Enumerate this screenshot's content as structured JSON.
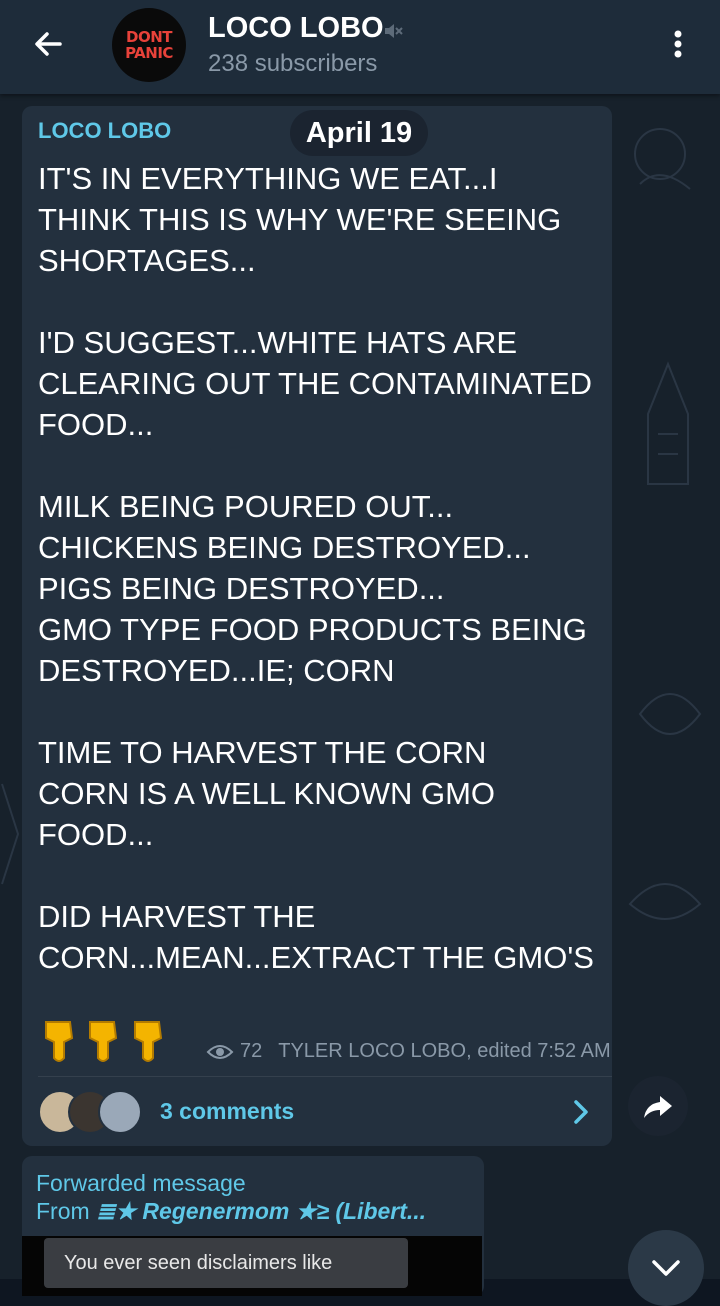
{
  "header": {
    "channel_name": "LOCO LOBO",
    "subscribers": "238 subscribers",
    "avatar_text_line1": "DONT",
    "avatar_text_line2": "PANIC"
  },
  "message": {
    "sender": "LOCO LOBO",
    "date": "April 19",
    "text": "IT'S IN EVERYTHING WE EAT...I THINK THIS IS WHY WE'RE SEEING SHORTAGES...\n\nI'D SUGGEST...WHITE HATS ARE CLEARING OUT THE CONTAMINATED FOOD...\n\nMILK BEING POURED OUT...\nCHICKENS BEING DESTROYED...\nPIGS BEING DESTROYED...\nGMO TYPE FOOD PRODUCTS BEING DESTROYED...IE; CORN\n\nTIME TO HARVEST THE CORN\nCORN IS A WELL KNOWN GMO FOOD...\n\nDID HARVEST THE CORN...MEAN...EXTRACT THE GMO'S",
    "emoji": "👇👇👇",
    "views": "72",
    "author_edited": "TYLER LOCO LOBO, edited 7:52 AM",
    "comments_label": "3 comments"
  },
  "forwarded": {
    "title": "Forwarded message",
    "from_prefix": "From ",
    "from_name": "≣★ Regenermom ★≥ (Libert...",
    "caption": "You ever seen disclaimers like"
  },
  "colors": {
    "header_bg": "#1e2c3a",
    "chat_bg": "#17212b",
    "bubble_bg": "#23303e",
    "accent": "#5fc8e8",
    "meta_text": "#8a99a8"
  }
}
